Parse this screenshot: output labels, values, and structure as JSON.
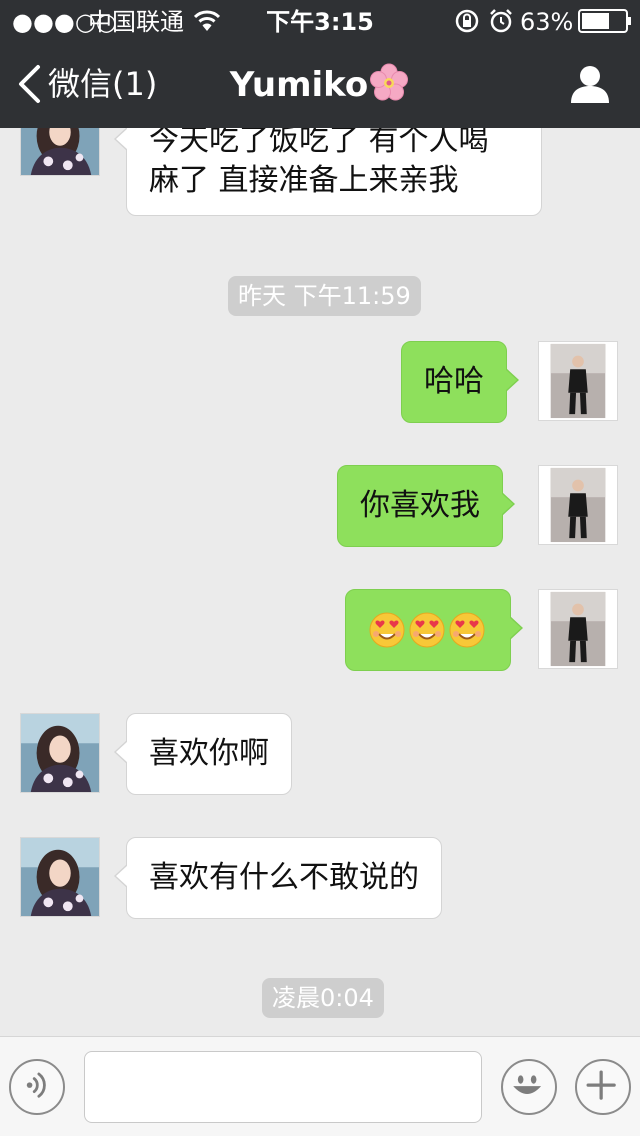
{
  "status_bar": {
    "signal": "●●●○○",
    "carrier": "中国联通",
    "time": "下午3:15",
    "battery": "63%"
  },
  "nav": {
    "back_label": "微信(1)",
    "title": "Yumiko"
  },
  "messages": [
    {
      "side": "in",
      "lines": [
        "今天吃了饭吃了 有个人喝",
        "麻了 直接准备上来亲我"
      ]
    },
    {
      "timestamp": "昨天 下午11:59"
    },
    {
      "side": "out",
      "text": "哈哈"
    },
    {
      "side": "out",
      "text": "你喜欢我"
    },
    {
      "side": "out",
      "emoji": [
        "heart-eyes-emoji",
        "heart-eyes-emoji",
        "heart-eyes-emoji"
      ]
    },
    {
      "side": "in",
      "text": "喜欢你啊"
    },
    {
      "side": "in",
      "text": "喜欢有什么不敢说的"
    },
    {
      "timestamp": "凌晨0:04"
    }
  ],
  "input_bar": {
    "message_value": "",
    "icons": [
      "voice-icon",
      "smiley-icon",
      "plus-icon"
    ]
  },
  "colors": {
    "header_bg": "#2f3134",
    "chat_bg": "#ebebeb",
    "outgoing_bubble": "#8ee05c",
    "incoming_bubble": "#ffffff",
    "timestamp_bg": "#cecece"
  }
}
